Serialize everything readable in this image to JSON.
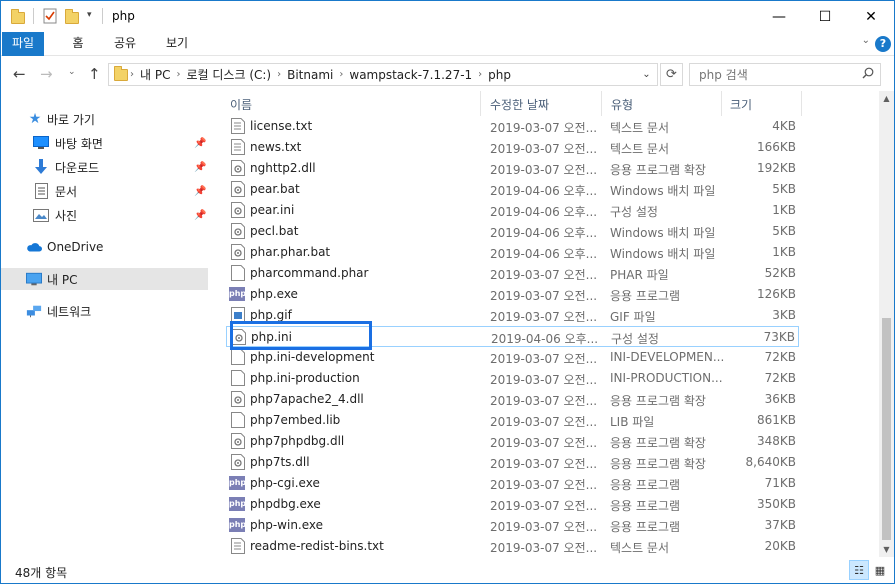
{
  "window": {
    "title": "php",
    "minimize": "—",
    "maximize": "☐",
    "close": "✕"
  },
  "ribbon": {
    "tabs": [
      "파일",
      "홈",
      "공유",
      "보기"
    ],
    "expand": "⌄",
    "help": "?"
  },
  "address": {
    "crumbs": [
      "내 PC",
      "로컬 디스크 (C:)",
      "Bitnami",
      "wampstack-7.1.27-1",
      "php"
    ],
    "search_placeholder": "php 검색"
  },
  "sidebar": {
    "items": [
      {
        "label": "바로 가기",
        "icon": "star-icon",
        "pinned": false
      },
      {
        "label": "바탕 화면",
        "icon": "desktop-icon",
        "pinned": true
      },
      {
        "label": "다운로드",
        "icon": "download-icon",
        "pinned": true
      },
      {
        "label": "문서",
        "icon": "documents-icon",
        "pinned": true
      },
      {
        "label": "사진",
        "icon": "pictures-icon",
        "pinned": true
      },
      {
        "label": "OneDrive",
        "icon": "onedrive-icon",
        "pinned": false
      },
      {
        "label": "내 PC",
        "icon": "pc-icon",
        "pinned": false
      },
      {
        "label": "네트워크",
        "icon": "network-icon",
        "pinned": false
      }
    ]
  },
  "columns": {
    "name": "이름",
    "date": "수정한 날짜",
    "type": "유형",
    "size": "크기"
  },
  "files": [
    {
      "name": "license.txt",
      "date": "2019-03-07 오전...",
      "type": "텍스트 문서",
      "size": "4KB",
      "icon": "text-file-icon"
    },
    {
      "name": "news.txt",
      "date": "2019-03-07 오전...",
      "type": "텍스트 문서",
      "size": "166KB",
      "icon": "text-file-icon"
    },
    {
      "name": "nghttp2.dll",
      "date": "2019-03-07 오전...",
      "type": "응용 프로그램 확장",
      "size": "192KB",
      "icon": "dll-file-icon"
    },
    {
      "name": "pear.bat",
      "date": "2019-04-06 오후...",
      "type": "Windows 배치 파일",
      "size": "5KB",
      "icon": "bat-file-icon"
    },
    {
      "name": "pear.ini",
      "date": "2019-04-06 오후...",
      "type": "구성 설정",
      "size": "1KB",
      "icon": "ini-file-icon"
    },
    {
      "name": "pecl.bat",
      "date": "2019-04-06 오후...",
      "type": "Windows 배치 파일",
      "size": "5KB",
      "icon": "bat-file-icon"
    },
    {
      "name": "phar.phar.bat",
      "date": "2019-04-06 오후...",
      "type": "Windows 배치 파일",
      "size": "1KB",
      "icon": "bat-file-icon"
    },
    {
      "name": "pharcommand.phar",
      "date": "2019-03-07 오전...",
      "type": "PHAR 파일",
      "size": "52KB",
      "icon": "blank-file-icon"
    },
    {
      "name": "php.exe",
      "date": "2019-03-07 오전...",
      "type": "응용 프로그램",
      "size": "126KB",
      "icon": "php-exe-icon"
    },
    {
      "name": "php.gif",
      "date": "2019-03-07 오전...",
      "type": "GIF 파일",
      "size": "3KB",
      "icon": "image-file-icon"
    },
    {
      "name": "php.ini",
      "date": "2019-04-06 오후...",
      "type": "구성 설정",
      "size": "73KB",
      "icon": "ini-file-icon",
      "selected": true
    },
    {
      "name": "php.ini-development",
      "date": "2019-03-07 오전...",
      "type": "INI-DEVELOPMEN...",
      "size": "72KB",
      "icon": "blank-file-icon"
    },
    {
      "name": "php.ini-production",
      "date": "2019-03-07 오전...",
      "type": "INI-PRODUCTION...",
      "size": "72KB",
      "icon": "blank-file-icon"
    },
    {
      "name": "php7apache2_4.dll",
      "date": "2019-03-07 오전...",
      "type": "응용 프로그램 확장",
      "size": "36KB",
      "icon": "dll-file-icon"
    },
    {
      "name": "php7embed.lib",
      "date": "2019-03-07 오전...",
      "type": "LIB 파일",
      "size": "861KB",
      "icon": "blank-file-icon"
    },
    {
      "name": "php7phpdbg.dll",
      "date": "2019-03-07 오전...",
      "type": "응용 프로그램 확장",
      "size": "348KB",
      "icon": "dll-file-icon"
    },
    {
      "name": "php7ts.dll",
      "date": "2019-03-07 오전...",
      "type": "응용 프로그램 확장",
      "size": "8,640KB",
      "icon": "dll-file-icon"
    },
    {
      "name": "php-cgi.exe",
      "date": "2019-03-07 오전...",
      "type": "응용 프로그램",
      "size": "71KB",
      "icon": "php-exe-icon"
    },
    {
      "name": "phpdbg.exe",
      "date": "2019-03-07 오전...",
      "type": "응용 프로그램",
      "size": "350KB",
      "icon": "php-exe-icon"
    },
    {
      "name": "php-win.exe",
      "date": "2019-03-07 오전...",
      "type": "응용 프로그램",
      "size": "37KB",
      "icon": "php-exe-icon"
    },
    {
      "name": "readme-redist-bins.txt",
      "date": "2019-03-07 오전...",
      "type": "텍스트 문서",
      "size": "20KB",
      "icon": "text-file-icon"
    }
  ],
  "status": {
    "count": "48개 항목"
  },
  "colors": {
    "accent": "#1979ca",
    "highlight_box": "#1a6fe3",
    "selection_border": "#99d1ff"
  }
}
